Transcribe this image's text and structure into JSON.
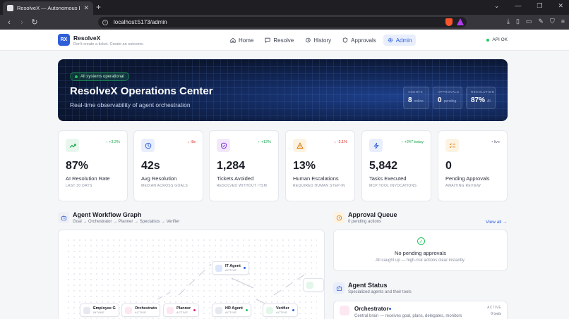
{
  "browser": {
    "tab_title": "ResolveX — Autonomous Emplo...",
    "url": "localhost:5173/admin"
  },
  "header": {
    "logo_text": "RX",
    "brand": "ResolveX",
    "tagline": "Don't create a ticket. Create an outcome.",
    "nav": [
      {
        "label": "Home",
        "icon": "home-icon"
      },
      {
        "label": "Resolve",
        "icon": "chat-icon"
      },
      {
        "label": "History",
        "icon": "history-icon"
      },
      {
        "label": "Approvals",
        "icon": "shield-check-icon"
      },
      {
        "label": "Admin",
        "icon": "gear-icon",
        "active": true
      }
    ],
    "api_status": "API OK"
  },
  "hero": {
    "pill": "All systems operational",
    "title": "ResolveX Operations Center",
    "subtitle": "Real-time observability of agent orchestration",
    "stats": [
      {
        "label": "AGENTS",
        "value": "8",
        "unit": "online"
      },
      {
        "label": "APPROVALS",
        "value": "0",
        "unit": "pending"
      },
      {
        "label": "RESOLUTION",
        "value": "87%",
        "unit": "AI"
      }
    ]
  },
  "kpis": [
    {
      "icon": "trend-up-icon",
      "delta": "↑ +3.2%",
      "value": "87%",
      "label": "AI Resolution Rate",
      "sub": "LAST 30 DAYS",
      "accent": "#16a34a",
      "bg": "#e8f7ee"
    },
    {
      "icon": "clock-icon",
      "delta": "↓ -8s",
      "value": "42s",
      "label": "Avg Resolution",
      "sub": "MEDIAN ACROSS GOALS",
      "accent": "#2f5fd8",
      "bg": "#e8eefc"
    },
    {
      "icon": "shield-icon",
      "delta": "↑ +12%",
      "value": "1,284",
      "label": "Tickets Avoided",
      "sub": "RESOLVED WITHOUT ITSM",
      "accent": "#8b3fd9",
      "bg": "#f2e8fc"
    },
    {
      "icon": "warning-icon",
      "delta": "↓ -2.1%",
      "value": "13%",
      "label": "Human Escalations",
      "sub": "REQUIRED HUMAN STEP-IN",
      "accent": "#d97706",
      "bg": "#fdf3e2"
    },
    {
      "icon": "bolt-icon",
      "delta": "↑ +247 today",
      "value": "5,842",
      "label": "Tasks Executed",
      "sub": "MCP TOOL INVOCATIONS",
      "accent": "#2f5fd8",
      "bg": "#e8eefc"
    },
    {
      "icon": "checklist-icon",
      "delta": "• live",
      "value": "0",
      "label": "Pending Approvals",
      "sub": "AWAITING REVIEW",
      "accent": "#d97706",
      "bg": "#fdf3e2"
    }
  ],
  "workflow": {
    "title": "Agent Workflow Graph",
    "subtitle": "Goal → Orchestrator → Planner → Specialists → Verifier",
    "nodes": [
      {
        "name": "IT Agent",
        "state": "ACTIVE",
        "icon_color": "#dbe6fb",
        "dot": "#2f5fd8"
      },
      {
        "name": "Employee G",
        "state": "INTAKE",
        "icon_color": "#e7e9f0",
        "dot": ""
      },
      {
        "name": "Orchestrato",
        "state": "ACTIVE",
        "icon_color": "#fde7f1",
        "dot": ""
      },
      {
        "name": "Planner",
        "state": "ACTIVE",
        "icon_color": "#fde7f1",
        "dot": "#e11d74"
      },
      {
        "name": "HR Agent",
        "state": "ACTIVE",
        "icon_color": "#e7e9f0",
        "dot": "#22c55e"
      },
      {
        "name": "Verifier",
        "state": "ACTIVE",
        "icon_color": "#e3f6ea",
        "dot": "#2f5fd8"
      }
    ]
  },
  "queue": {
    "title": "Approval Queue",
    "subtitle": "0 pending actions",
    "view_all": "View all →",
    "empty_title": "No pending approvals",
    "empty_sub": "All caught up — high-risk actions clear instantly."
  },
  "agent_status": {
    "title": "Agent Status",
    "subtitle": "Specialized agents and their tools",
    "first": {
      "name": "Orchestrator",
      "desc": "Central brain — receives goal, plans, delegates, monitors",
      "state": "ACTIVE",
      "tools": "0 tools"
    }
  }
}
